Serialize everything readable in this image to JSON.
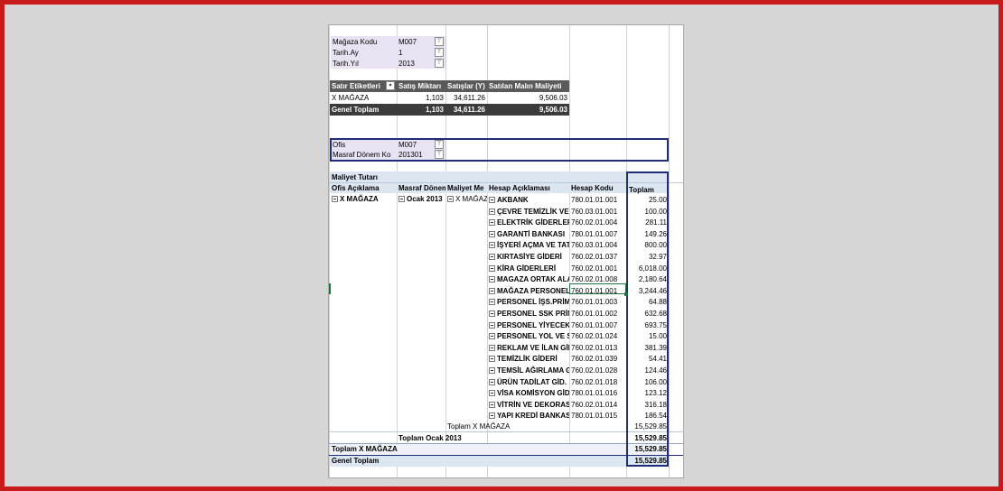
{
  "filters1": [
    {
      "label": "Mağaza Kodu",
      "value": "M007"
    },
    {
      "label": "Tarih.Ay",
      "value": "1"
    },
    {
      "label": "Tarih.Yıl",
      "value": "2013"
    }
  ],
  "pivot1": {
    "headers": [
      "Satır Etiketleri",
      "Satış Miktarı",
      "Satışlar (Y)",
      "Satılan Malın Maliyeti"
    ],
    "row": [
      "X MAĞAZA",
      "1,103",
      "34,611.26",
      "9,506.03"
    ],
    "total": [
      "Genel Toplam",
      "1,103",
      "34,611.26",
      "9,506.03"
    ]
  },
  "filters2": [
    {
      "label": "Ofis",
      "value": "M007"
    },
    {
      "label": "Masraf Dönem Ko",
      "value": "201301"
    }
  ],
  "pivot2": {
    "measure": "Maliyet Tutarı",
    "headers": [
      "Ofis Açıklama",
      "Masraf Dönem",
      "Maliyet Me",
      "Hesap Açıklaması",
      "Hesap Kodu",
      "Toplam"
    ],
    "ofis": "X MAĞAZA",
    "donem": "Ocak 2013",
    "merkez": "X MAĞAZA",
    "rows": [
      {
        "name": "AKBANK",
        "code": "780.01.01.001",
        "total": "25.00"
      },
      {
        "name": "ÇEVRE TEMİZLİK VER",
        "code": "760.03.01.001",
        "total": "100.00"
      },
      {
        "name": "ELEKTRİK GİDERLERİ",
        "code": "760.02.01.004",
        "total": "281.11"
      },
      {
        "name": "GARANTİ BANKASI",
        "code": "780.01.01.007",
        "total": "149.26"
      },
      {
        "name": "İŞYERİ AÇMA VE TAT",
        "code": "760.03.01.004",
        "total": "800.00"
      },
      {
        "name": "KIRTASİYE GİDERİ",
        "code": "760.02.01.037",
        "total": "32.97"
      },
      {
        "name": "KİRA GİDERLERİ",
        "code": "760.02.01.001",
        "total": "6,018.00"
      },
      {
        "name": "MAGAZA ORTAK ALA",
        "code": "760.02.01.008",
        "total": "2,180.64"
      },
      {
        "name": "MAĞAZA PERSONEL",
        "code": "760.01.01.001",
        "total": "3,244.46"
      },
      {
        "name": "PERSONEL İŞS.PRİM",
        "code": "760.01.01.003",
        "total": "64.88"
      },
      {
        "name": "PERSONEL SSK PRİM",
        "code": "760.01.01.002",
        "total": "632.68"
      },
      {
        "name": "PERSONEL YİYECEK G",
        "code": "760.01.01.007",
        "total": "693.75"
      },
      {
        "name": "PERSONEL YOL VE SE",
        "code": "760.02.01.024",
        "total": "15.00"
      },
      {
        "name": "REKLAM VE İLAN GİD",
        "code": "760.02.01.013",
        "total": "381.39"
      },
      {
        "name": "TEMİZLİK GİDERİ",
        "code": "760.02.01.039",
        "total": "54.41"
      },
      {
        "name": "TEMSİL AĞIRLAMA G",
        "code": "760.02.01.028",
        "total": "124.46"
      },
      {
        "name": "ÜRÜN TADİLAT GİD.",
        "code": "760.02.01.018",
        "total": "106.00"
      },
      {
        "name": "VİSA KOMİSYON GİD",
        "code": "780.01.01.016",
        "total": "123.12"
      },
      {
        "name": "VİTRİN VE DEKORASY",
        "code": "760.02.01.014",
        "total": "316.18"
      },
      {
        "name": "YAPI KREDİ BANKASI",
        "code": "780.01.01.015",
        "total": "186.54"
      }
    ],
    "subtotals": [
      {
        "label": "Toplam X MAĞAZA",
        "total": "15,529.85"
      },
      {
        "label": "Toplam Ocak 2013",
        "total": "15,529.85"
      },
      {
        "label": "Toplam X MAĞAZA",
        "total": "15,529.85"
      },
      {
        "label": "Genel Toplam",
        "total": "15,529.85"
      }
    ]
  }
}
